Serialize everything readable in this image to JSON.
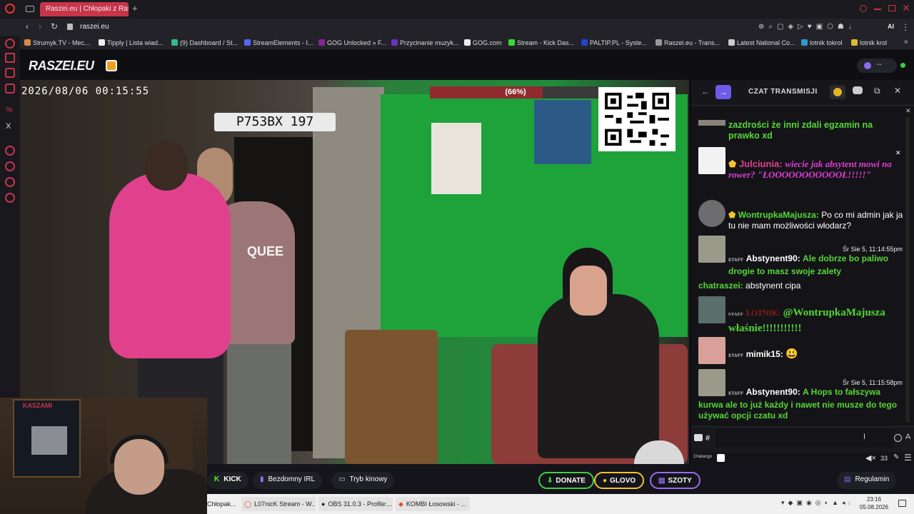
{
  "browser": {
    "tabs": [
      {
        "label": "Raszei.eu | Chłopaki z Rasz",
        "active": true
      }
    ],
    "new_tab": "+",
    "url": "raszei.eu",
    "bookmarks": [
      "Strumyk.TV - Mec...",
      "Tipply | Lista wiad...",
      "(9) Dashboard / St...",
      "StreamElements - I...",
      "GOG Unlocked » F...",
      "Przycinanie muzyk...",
      "GOG.com",
      "Stream - Kick Das...",
      "PALTIP.PL - Syste...",
      "Raszei.eu - Trans...",
      "Latest National Co...",
      "lotnik tokrol",
      "lotnik krol"
    ],
    "ai_label": "AI"
  },
  "site": {
    "logo": "RASZEI.EU",
    "status_text": "--"
  },
  "video": {
    "timestamp": "2026/08/06  00:15:55",
    "plate": "P753BX 197",
    "progress_text": "(66%)",
    "progress": 0.66,
    "shirt_text": "QUEE"
  },
  "chat": {
    "title": "CZAT TRANSMISJI",
    "messages": [
      {
        "user": "",
        "text": "zazdrości że inni zdali egzamin na prawko xd",
        "style": "green"
      },
      {
        "user": "Julciunia:",
        "text": "wiecie jak absytent mowi na rower? \"ŁOOOOOOOOOOOŁ!!!!!\"",
        "style": "pink"
      },
      {
        "user": "WontrupkaMajusza:",
        "text": "Po co mi admin jak ja tu nie mam możliwości włodarz?",
        "style": "white"
      },
      {
        "user": "Abstynent90:",
        "time": "Śr Sie 5, 11:14:55pm",
        "text": "Ale dobrze bo paliwo drogie to masz swoje zalety",
        "style": "green"
      },
      {
        "user": "chatraszei:",
        "text": "abstynent cipa",
        "style": "white"
      },
      {
        "user": "LOTNIK:",
        "text": "@WontrupkaMajusza właśnie!!!!!!!!!!!",
        "style": "greenbig"
      },
      {
        "user": "mimik15:",
        "text": "😃",
        "style": "white"
      },
      {
        "user": "Abstynent90:",
        "time": "Śr Sie 5, 11:15:58pm",
        "text": "A Hops to fałszywa kurwa ale to już każdy i nawet nie musze do tego używać opcji czatu xd",
        "style": "green"
      }
    ],
    "staff_badge": "STAFF",
    "hash": "#",
    "footer_label": "Chatango",
    "viewer_count": "33"
  },
  "bottombar": {
    "kick": "KICK",
    "irl": "Bezdomny IRL",
    "cinema": "Tryb kinowy",
    "donate": "DONATE",
    "glovo": "GLOVO",
    "szoty": "SZOTY",
    "rules": "Regulamin"
  },
  "taskbar": {
    "items": [
      "Chłopak...",
      "L07nicK Stream - W...",
      "OBS 31.0.3 - Profile:...",
      "KOMBI Łosowski - ..."
    ],
    "time": "23:16",
    "date": "05.08.2026"
  },
  "webcam": {
    "poster_text": "KASZAMI"
  },
  "colors": {
    "accent_green": "#55d636",
    "accent_pink": "#e0418d",
    "chat_bg": "#141418",
    "progress": "#8f2b2e"
  }
}
